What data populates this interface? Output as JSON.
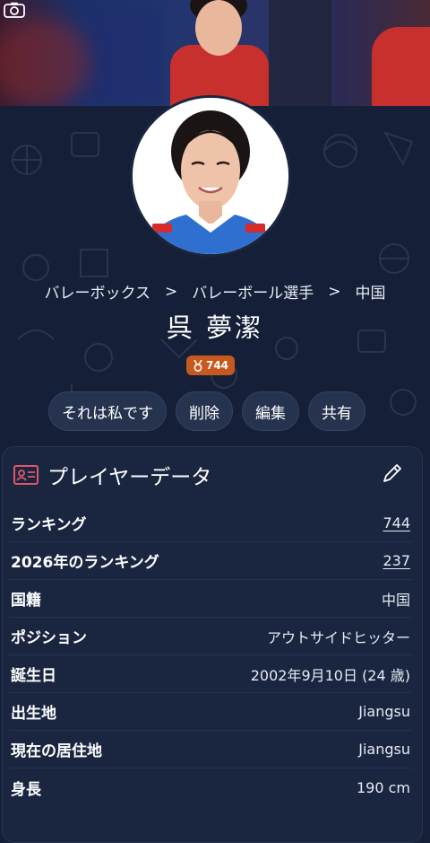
{
  "banner": {
    "camera_icon": "camera-icon"
  },
  "breadcrumb": [
    {
      "label": "バレーボックス"
    },
    {
      "label": "バレーボール選手"
    },
    {
      "label": "中国"
    }
  ],
  "breadcrumb_separator": ">",
  "player": {
    "name": "呉 夢潔",
    "rank_badge": "744",
    "badge_color": "#c7591e"
  },
  "actions": [
    {
      "label": "それは私です"
    },
    {
      "label": "削除"
    },
    {
      "label": "編集"
    },
    {
      "label": "共有"
    }
  ],
  "card": {
    "title": "プレイヤーデータ",
    "icon": "id-card-icon",
    "edit_icon": "pencil-icon",
    "rows": [
      {
        "label": "ランキング",
        "value": "744",
        "link": true
      },
      {
        "label": "2026年のランキング",
        "value": "237",
        "link": true
      },
      {
        "label": "国籍",
        "value": "中国",
        "link": false
      },
      {
        "label": "ポジション",
        "value": "アウトサイドヒッター",
        "link": false
      },
      {
        "label": "誕生日",
        "value": "2002年9月10日 (24 歳)",
        "link": false
      },
      {
        "label": "出生地",
        "value": "Jiangsu",
        "link": false
      },
      {
        "label": "現在の居住地",
        "value": "Jiangsu",
        "link": false
      },
      {
        "label": "身長",
        "value": "190 cm",
        "link": false
      }
    ]
  },
  "colors": {
    "background": "#152038",
    "card": "#1a2640",
    "button": "#25334f",
    "accent_icon": "#e0566b"
  }
}
